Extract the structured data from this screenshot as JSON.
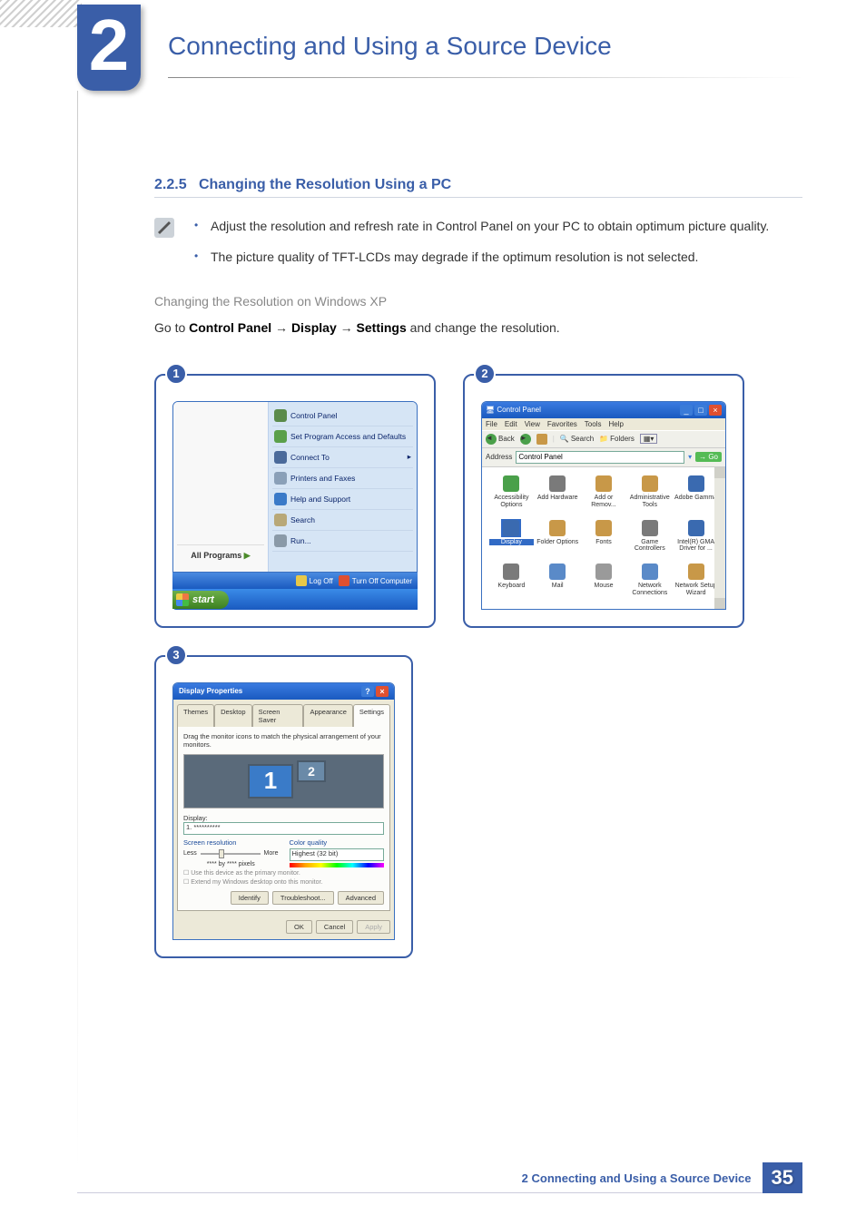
{
  "chapter": {
    "number": "2",
    "title": "Connecting and Using a Source Device"
  },
  "section": {
    "number": "2.2.5",
    "title": "Changing the Resolution Using a PC"
  },
  "bullets": [
    "Adjust the resolution and refresh rate in Control Panel on your PC to obtain optimum picture quality.",
    "The picture quality of TFT-LCDs may degrade if the optimum resolution is not selected."
  ],
  "subheading": "Changing the Resolution on Windows XP",
  "instruction": {
    "prefix": "Go to ",
    "path": [
      "Control Panel",
      "Display",
      "Settings"
    ],
    "suffix": " and change the resolution.",
    "arrow": "→"
  },
  "figure1": {
    "num": "1",
    "right_menu": [
      {
        "label": "Control Panel",
        "color": "#5a8a4a"
      },
      {
        "label": "Set Program Access and Defaults",
        "color": "#5aa04a"
      },
      {
        "label": "Connect To",
        "color": "#4a6a9a",
        "arrow": "▸"
      },
      {
        "label": "Printers and Faxes",
        "color": "#8aa0b8"
      },
      {
        "label": "Help and Support",
        "color": "#3a7ac8"
      },
      {
        "label": "Search",
        "color": "#b8a878"
      },
      {
        "label": "Run...",
        "color": "#8a9aa8"
      }
    ],
    "all_programs": "All Programs",
    "logoff": "Log Off",
    "turnoff": "Turn Off Computer",
    "start": "start"
  },
  "figure2": {
    "num": "2",
    "title": "Control Panel",
    "menu": [
      "File",
      "Edit",
      "View",
      "Favorites",
      "Tools",
      "Help"
    ],
    "toolbar": {
      "back": "Back",
      "search": "Search",
      "folders": "Folders"
    },
    "address_label": "Address",
    "address_value": "Control Panel",
    "go": "Go",
    "items": [
      {
        "label": "Accessibility Options",
        "color": "#4aa04a"
      },
      {
        "label": "Add Hardware",
        "color": "#7a7a7a"
      },
      {
        "label": "Add or Remov...",
        "color": "#c89848"
      },
      {
        "label": "Administrative Tools",
        "color": "#c89848"
      },
      {
        "label": "Adobe Gamma",
        "color": "#3a6ab0"
      },
      {
        "label": "Display",
        "color": "#3a6ab0",
        "highlight": true
      },
      {
        "label": "Folder Options",
        "color": "#c89848"
      },
      {
        "label": "Fonts",
        "color": "#c89848"
      },
      {
        "label": "Game Controllers",
        "color": "#7a7a7a"
      },
      {
        "label": "Intel(R) GMA Driver for ...",
        "color": "#3a6ab0"
      },
      {
        "label": "Keyboard",
        "color": "#7a7a7a"
      },
      {
        "label": "Mail",
        "color": "#5a8ac8"
      },
      {
        "label": "Mouse",
        "color": "#9a9a9a"
      },
      {
        "label": "Network Connections",
        "color": "#5a8ac8"
      },
      {
        "label": "Network Setup Wizard",
        "color": "#c89848"
      }
    ]
  },
  "figure3": {
    "num": "3",
    "title": "Display Properties",
    "tabs": [
      "Themes",
      "Desktop",
      "Screen Saver",
      "Appearance",
      "Settings"
    ],
    "active_tab": "Settings",
    "hint": "Drag the monitor icons to match the physical arrangement of your monitors.",
    "mon1": "1",
    "mon2": "2",
    "display_label": "Display:",
    "display_value": "1. **********",
    "screen_res_label": "Screen resolution",
    "less": "Less",
    "more": "More",
    "res_value": "**** by **** pixels",
    "color_label": "Color quality",
    "color_value": "Highest (32 bit)",
    "check1": "Use this device as the primary monitor.",
    "check2": "Extend my Windows desktop onto this monitor.",
    "btns_mid": [
      "Identify",
      "Troubleshoot...",
      "Advanced"
    ],
    "btns_foot": [
      "OK",
      "Cancel",
      "Apply"
    ]
  },
  "footer": {
    "text": "2 Connecting and Using a Source Device",
    "page": "35"
  }
}
